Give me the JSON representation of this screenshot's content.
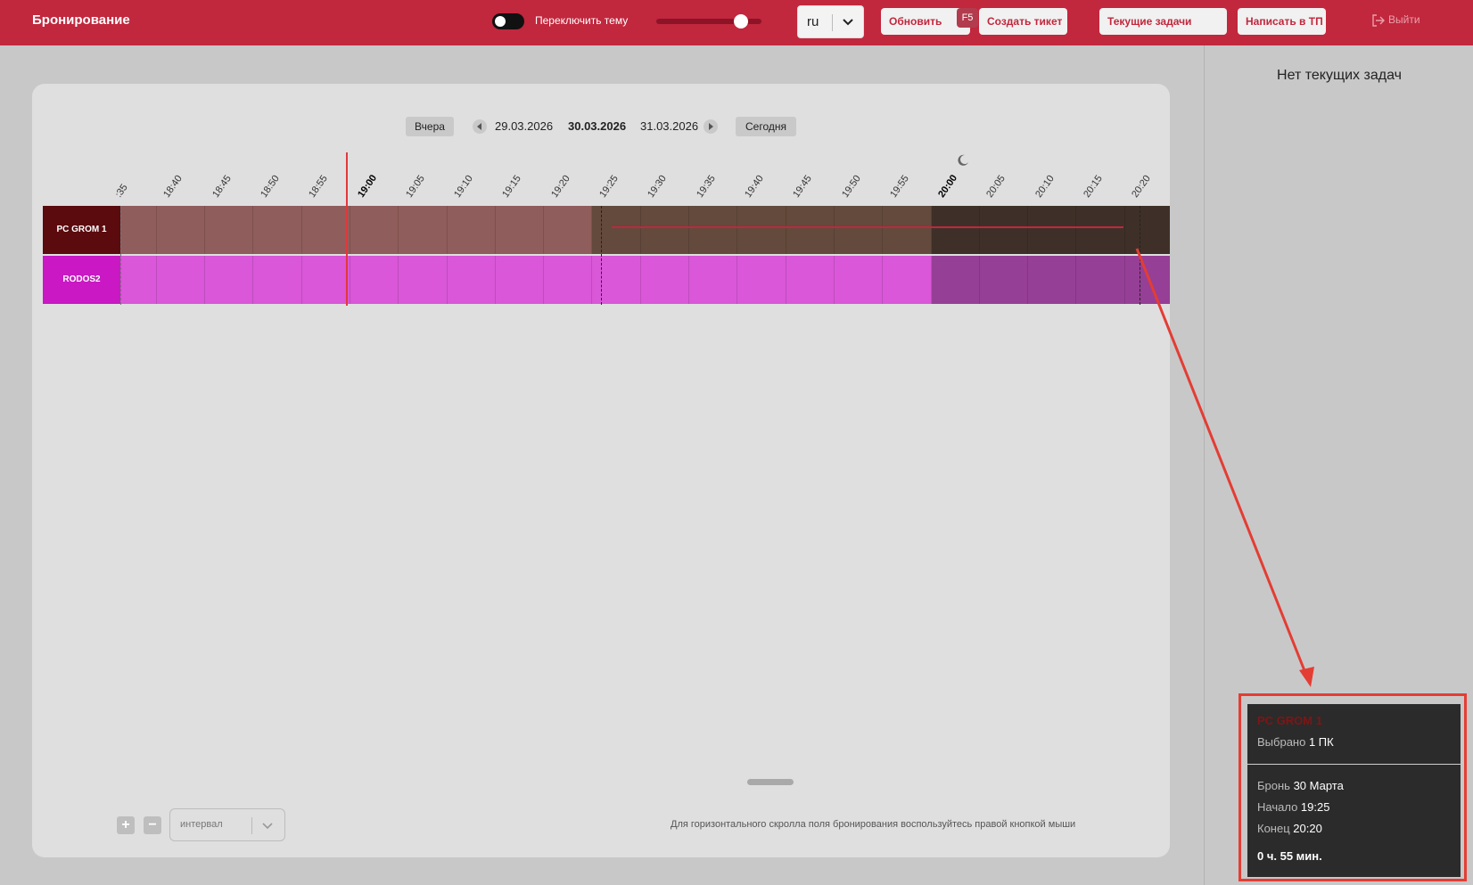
{
  "header": {
    "title": "Бронирование",
    "theme_toggle_label": "Переключить тему",
    "language": "ru",
    "refresh_label": "Обновить",
    "refresh_hotkey": "F5",
    "create_ticket_label": "Создать тикет",
    "current_tasks_label": "Текущие задачи",
    "write_support_label": "Написать в ТП",
    "logout_label": "Выйти",
    "accent_color": "#c1273d"
  },
  "right_panel": {
    "empty_text": "Нет текущих задач"
  },
  "datebar": {
    "yesterday": "Вчера",
    "prev_date": "29.03.2026",
    "current_date": "30.03.2026",
    "next_date": "31.03.2026",
    "today": "Сегодня"
  },
  "timeline": {
    "ticks": [
      ":35",
      "18:40",
      "18:45",
      "18:50",
      "18:55",
      "19:00",
      "19:05",
      "19:10",
      "19:15",
      "19:20",
      "19:25",
      "19:30",
      "19:35",
      "19:40",
      "19:45",
      "19:50",
      "19:55",
      "20:00",
      "20:05",
      "20:10",
      "20:15",
      "20:20"
    ],
    "bold_ticks": [
      "19:00",
      "20:00"
    ],
    "night_icon": "moon-icon"
  },
  "rows": [
    {
      "label": "PC GROM 1",
      "label_color": "#5b0a0e",
      "cell_color": "#8f5d5b",
      "booked_color": "#634a3c",
      "night_color": "#3e3028"
    },
    {
      "label": "RODOS2",
      "label_color": "#c918c4",
      "cell_color": "#d957d8",
      "booked_color": "#d957d8",
      "night_color": "#963f96"
    }
  ],
  "footer": {
    "interval_placeholder": "интервал",
    "zoom_in": "+",
    "zoom_out": "−",
    "hint": "Для горизонтального скролла поля бронирования воспользуйтесь правой кнопкой мыши"
  },
  "tooltip": {
    "pc_name": "PC GROM 1",
    "selected_label": "Выбрано",
    "selected_value": "1 ПК",
    "booking_label": "Бронь",
    "booking_value": "30 Марта",
    "start_label": "Начало",
    "start_value": "19:25",
    "end_label": "Конец",
    "end_value": "20:20",
    "duration": "0 ч. 55 мин."
  }
}
